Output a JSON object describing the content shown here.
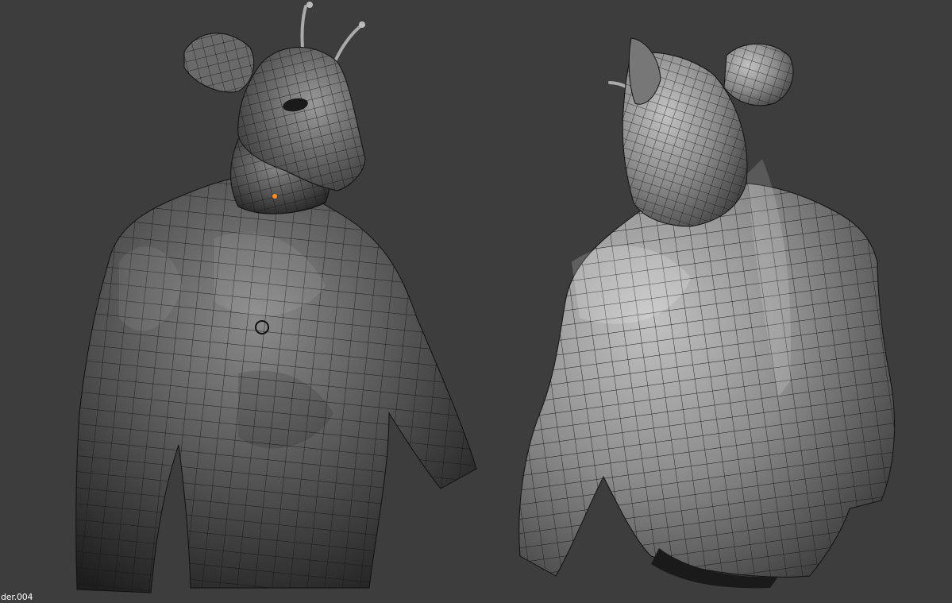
{
  "viewport": {
    "object_name": "der.004",
    "background_color": "#3d3d3d",
    "mesh_color": "#9a9a9a",
    "wire_color": "#141414",
    "selected_vertex_color": "#ff8c1a"
  }
}
